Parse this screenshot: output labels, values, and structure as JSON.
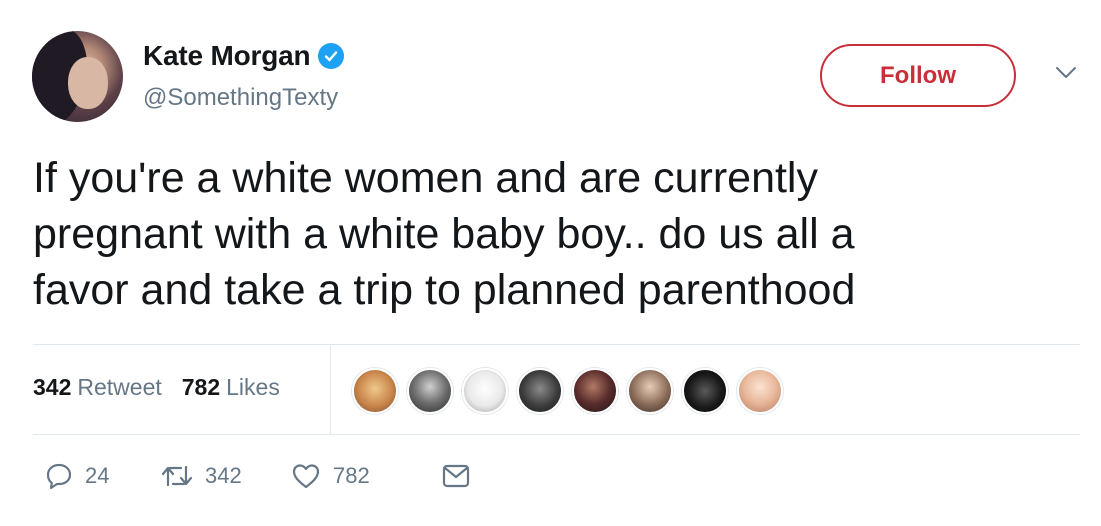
{
  "user": {
    "display_name": "Kate Morgan",
    "handle": "@SomethingTexty",
    "verified": true
  },
  "follow_label": "Follow",
  "tweet": {
    "line1": "If you're a white women and are currently",
    "line2": "pregnant with a white baby boy.. do us all a",
    "line3": "favor and take a trip to planned parenthood"
  },
  "stats": {
    "retweets_count": "342",
    "retweets_label": "Retweet",
    "likes_count": "782",
    "likes_label": "Likes"
  },
  "actions": {
    "reply_count": "24",
    "retweet_count": "342",
    "like_count": "782"
  },
  "colors": {
    "accent_red": "#c7303a",
    "verified_blue": "#1da1f2",
    "muted": "#657786",
    "text": "#14171a"
  },
  "icons": [
    "verified-badge-icon",
    "chevron-down-icon",
    "reply-icon",
    "retweet-icon",
    "heart-icon",
    "direct-message-icon"
  ]
}
